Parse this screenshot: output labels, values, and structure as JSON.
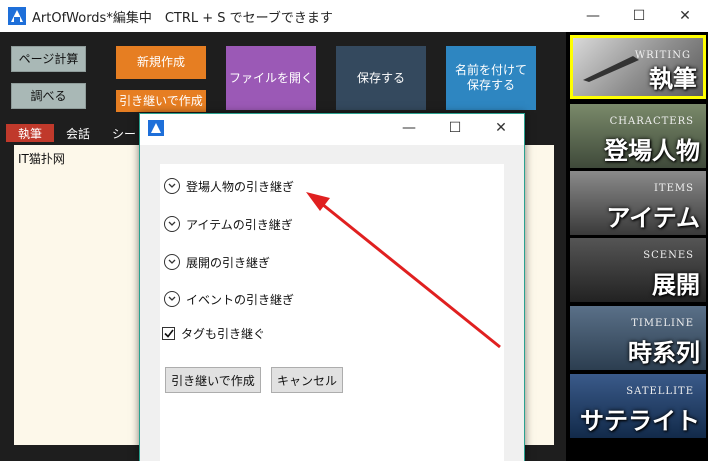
{
  "window": {
    "title": "ArtOfWords*編集中　CTRL + S でセーブできます",
    "minimize": "—",
    "maximize": "☐",
    "close": "✕"
  },
  "toolbar": {
    "page_calc": "ページ計算",
    "lookup": "調べる",
    "new": "新規作成",
    "inherit_new": "引き継いで作成",
    "open": "ファイルを開く",
    "save": "保存する",
    "save_as": "名前を付けて\n保存する"
  },
  "tabs": [
    "執筆",
    "会話",
    "シー"
  ],
  "editor": {
    "text": "IT猫扑网"
  },
  "side_panels": [
    {
      "en": "WRITING",
      "jp": "執筆",
      "selected": true
    },
    {
      "en": "CHARACTERS",
      "jp": "登場人物"
    },
    {
      "en": "ITEMS",
      "jp": "アイテム"
    },
    {
      "en": "SCENES",
      "jp": "展開"
    },
    {
      "en": "TIMELINE",
      "jp": "時系列"
    },
    {
      "en": "SATELLITE",
      "jp": "サテライト"
    }
  ],
  "dialog": {
    "minimize": "—",
    "maximize": "☐",
    "close": "✕",
    "expanders": [
      "登場人物の引き継ぎ",
      "アイテムの引き継ぎ",
      "展開の引き継ぎ",
      "イベントの引き継ぎ"
    ],
    "tag_checkbox": {
      "label": "タグも引き継ぐ",
      "checked": true
    },
    "create_button": "引き継いで作成",
    "cancel_button": "キャンセル"
  },
  "colors": {
    "accent_teal": "#2aa18f",
    "arrow": "#e02020",
    "selected_border": "#ffff00"
  }
}
